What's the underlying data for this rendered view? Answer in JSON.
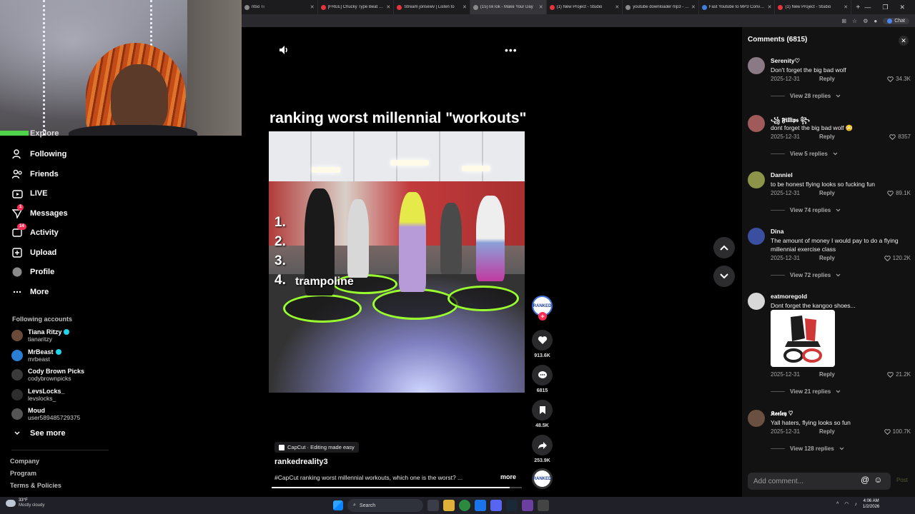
{
  "browser": {
    "tabs": [
      {
        "label": "ntso Ti",
        "fav": "gray"
      },
      {
        "label": "[FREE] Chucky Type Beat - \"MY",
        "fav": "red"
      },
      {
        "label": "Stream jonsewv | Listen to",
        "fav": "red"
      },
      {
        "label": "(15)TikTok - Make Your Day",
        "fav": "gray",
        "active": true
      },
      {
        "label": "(1) New Project - Studio",
        "fav": "red"
      },
      {
        "label": "youtube downloader mp3 - Sea",
        "fav": "gray"
      },
      {
        "label": "Fast Youtube to MP3 Converter",
        "fav": "blue"
      },
      {
        "label": "(1) New Project - Studio",
        "fav": "red"
      }
    ],
    "new_tab": "+",
    "chat_label": "Chat"
  },
  "sidebar": {
    "partial_item": "Explore",
    "nav": [
      {
        "label": "Following",
        "icon": "following-icon"
      },
      {
        "label": "Friends",
        "icon": "friends-icon"
      },
      {
        "label": "LIVE",
        "icon": "live-icon"
      },
      {
        "label": "Messages",
        "icon": "messages-icon",
        "badge": "1"
      },
      {
        "label": "Activity",
        "icon": "activity-icon",
        "badge": "14"
      },
      {
        "label": "Upload",
        "icon": "upload-icon"
      },
      {
        "label": "Profile",
        "icon": "profile-icon"
      },
      {
        "label": "More",
        "icon": "more-icon"
      }
    ],
    "following_title": "Following accounts",
    "accounts": [
      {
        "name": "Tiana Ritzy",
        "handle": "tianaritzy",
        "verified": true
      },
      {
        "name": "MrBeast",
        "handle": "mrbeast",
        "verified": true
      },
      {
        "name": "Cody Brown Picks",
        "handle": "codybrownpicks",
        "verified": false
      },
      {
        "name": "LevsLocks_",
        "handle": "levslocks_",
        "verified": false
      },
      {
        "name": "Moud",
        "handle": "user589485729375",
        "verified": false
      }
    ],
    "see_more": "See more",
    "footer": [
      "Company",
      "Program",
      "Terms & Policies"
    ]
  },
  "video": {
    "title": "ranking worst millennial \"workouts\"",
    "ranks": [
      "1.",
      "2.",
      "3.",
      "4."
    ],
    "rank4_word": "trampoline",
    "capcut_label": "CapCut · Editing made easy",
    "author": "rankedreality3",
    "description": "#CapCut ranking worst millennial workouts, which one is the worst? ...",
    "more": "more",
    "progress": 0.95,
    "creator_avatar_text": "RANKED",
    "actions": {
      "likes": "913.6K",
      "comments": "6815",
      "saves": "48.5K",
      "shares": "253.9K"
    }
  },
  "comments": {
    "header": "Comments (6815)",
    "items": [
      {
        "user": "Serenity♡",
        "text": "Don't forget the big bad wolf",
        "date": "2025-12-31",
        "likes": "34.3K",
        "replies": "View 28 replies",
        "avatar": "#8a7a86"
      },
      {
        "user": "꧁ 𝕱𝖎𝖑𝖑𝖎𝖕𝖘 ꧂",
        "text": "dont forget the big bad wolf 😳",
        "date": "2025-12-31",
        "likes": "8357",
        "replies": "View 5 replies",
        "avatar": "#a05a5a"
      },
      {
        "user": "Danniel",
        "text": "to be honest flying looks so fucking fun",
        "date": "2025-12-31",
        "likes": "89.1K",
        "replies": "View 74 replies",
        "avatar": "#8b9448"
      },
      {
        "user": "Dina",
        "text": "The amount of money I would pay to do a flying millennial exercise class",
        "date": "2025-12-31",
        "likes": "120.2K",
        "replies": "View 72 replies",
        "avatar": "#3b4fa0"
      },
      {
        "user": "eatmoregold",
        "text": "Dont forget the kangoo shoes...",
        "date": "2025-12-31",
        "likes": "21.2K",
        "replies": "View 21 replies",
        "avatar": "#d8d8d8"
      },
      {
        "user": "𝕶𝖊𝖊𝖑𝖊𝖞 ♡",
        "text": "Yall haters, flying looks so fun",
        "date": "2025-12-31",
        "likes": "100.7K",
        "replies": "View 128 replies",
        "avatar": "#6a5040"
      }
    ],
    "reply_label": "Reply",
    "add_placeholder": "Add comment...",
    "post_label": "Post"
  },
  "taskbar": {
    "temp": "33°F",
    "weather": "Mostly cloudy",
    "search": "Search",
    "time": "4:06 AM",
    "date": "1/2/2026"
  },
  "colors": {
    "accent": "#fe2c55",
    "trampoline": "#9aff2e",
    "verified": "#20d5ec"
  }
}
